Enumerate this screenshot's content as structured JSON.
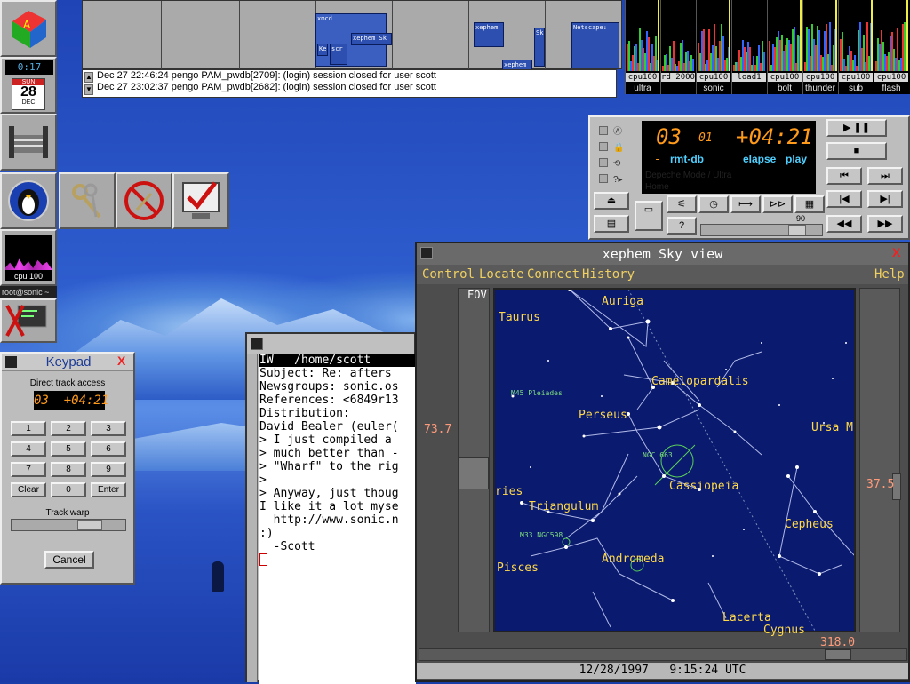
{
  "pager": {
    "windows": [
      "xmcd",
      "xephem Sk",
      "Ke",
      "scr",
      "xephem",
      "xephem",
      "Sk",
      "Netscape:"
    ]
  },
  "log": {
    "lines": [
      "Dec 27 22:46:24 pengo PAM_pwdb[2709]: (login) session closed for user scott",
      "Dec 27 23:02:37 pengo PAM_pwdb[2682]: (login) session closed for user scott"
    ]
  },
  "cpu": [
    {
      "label": "cpu100",
      "host": "ultra"
    },
    {
      "label": "rd 2000",
      "host": ""
    },
    {
      "label": "cpu100",
      "host": "sonic"
    },
    {
      "label": "load1",
      "host": ""
    },
    {
      "label": "cpu100",
      "host": "bolt"
    },
    {
      "label": "cpu100",
      "host": "thunder"
    },
    {
      "label": "cpu100",
      "host": "sub"
    },
    {
      "label": "cpu100",
      "host": "flash"
    }
  ],
  "dock": {
    "clock": "0:17",
    "cal_day": "SUN",
    "cal_date": "28",
    "cal_month": "DEC",
    "cpu_label": "cpu 100",
    "user_host": "root@sonic ~"
  },
  "cd": {
    "track": "03",
    "index": "01",
    "time": "+04:21",
    "mode1": "rmt-db",
    "mode2": "elapse",
    "mode3": "play",
    "dash": "-",
    "artist": "Depeche Mode / Ultra",
    "song": "Home",
    "volume": "90",
    "help": "?"
  },
  "xephem": {
    "title": "xephem Sky view",
    "menu": [
      "Control",
      "Locate",
      "Connect",
      "History"
    ],
    "help": "Help",
    "fov": "FOV",
    "left_value": "73.7",
    "right_value": "37.5",
    "bottom_value": "318.0",
    "status": "12/28/1997   9:15:24 UTC",
    "constellations": [
      "Auriga",
      "Taurus",
      "Camelopardalis",
      "Perseus",
      "Ursa M",
      "Cassiopeia",
      "ries",
      "Triangulum",
      "Cepheus",
      "Pisces",
      "Andromeda",
      "Lacerta",
      "Cygnus"
    ],
    "objects": [
      "M45 Pleiades",
      "NGC 663",
      "M33 NGC598"
    ]
  },
  "terminal": {
    "title": "IW   /home/scott",
    "lines": [
      "Subject: Re: afters",
      "Newsgroups: sonic.os",
      "References: <6849r13",
      "Distribution:",
      "",
      "David Bealer (euler(",
      "> I just compiled a",
      "> much better than -",
      "> \"Wharf\" to the rig",
      ">",
      "> Anyway, just thoug",
      "",
      "I like it a lot myse",
      "",
      "  http://www.sonic.n",
      "",
      ":)",
      "",
      "  -Scott"
    ]
  },
  "keypad": {
    "title": "Keypad",
    "subtitle": "Direct track access",
    "display": "03  +04:21",
    "keys": [
      "1",
      "2",
      "3",
      "4",
      "5",
      "6",
      "7",
      "8",
      "9",
      "Clear",
      "0",
      "Enter"
    ],
    "warp": "Track warp",
    "cancel": "Cancel"
  }
}
